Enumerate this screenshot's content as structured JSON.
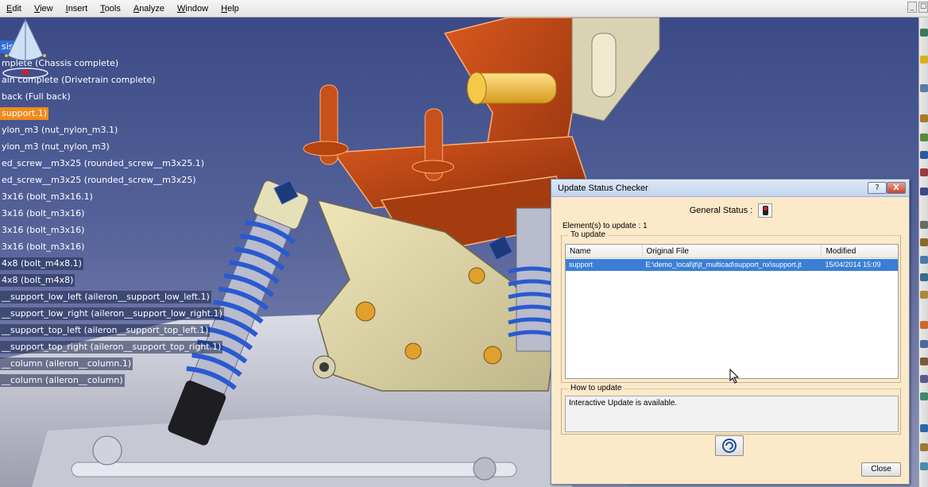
{
  "menu": [
    "Edit",
    "View",
    "Insert",
    "Tools",
    "Analyze",
    "Window",
    "Help"
  ],
  "window_buttons": [
    "_",
    "☐"
  ],
  "tree": [
    {
      "label": "sis",
      "style": "selected"
    },
    {
      "label": "mplete (Chassis complete)",
      "style": "plain"
    },
    {
      "label": "ain complete (Drivetrain complete)",
      "style": "plain"
    },
    {
      "label": "back (Full back)",
      "style": "plain"
    },
    {
      "label": "support.1)",
      "style": "orange"
    },
    {
      "label": "ylon_m3 (nut_nylon_m3.1)",
      "style": "plain"
    },
    {
      "label": "ylon_m3 (nut_nylon_m3)",
      "style": "plain"
    },
    {
      "label": "ed_screw__m3x25 (rounded_screw__m3x25.1)",
      "style": "plain"
    },
    {
      "label": "ed_screw__m3x25 (rounded_screw__m3x25)",
      "style": "plain"
    },
    {
      "label": "3x16 (bolt_m3x16.1)",
      "style": "plain"
    },
    {
      "label": "3x16 (bolt_m3x16)",
      "style": "plain"
    },
    {
      "label": "3x16 (bolt_m3x16)",
      "style": "plain"
    },
    {
      "label": "3x16 (bolt_m3x16)",
      "style": "plain"
    },
    {
      "label": "4x8 (bolt_m4x8.1)",
      "style": "boxed"
    },
    {
      "label": "4x8 (bolt_m4x8)",
      "style": "boxed"
    },
    {
      "label": "__support_low_left (aileron__support_low_left.1)",
      "style": "boxed"
    },
    {
      "label": "__support_low_right (aileron__support_low_right.1)",
      "style": "boxed"
    },
    {
      "label": "__support_top_left (aileron__support_top_left.1)",
      "style": "boxed"
    },
    {
      "label": "__support_top_right (aileron__support_top_right.1)",
      "style": "boxed"
    },
    {
      "label": "__column (aileron__column.1)",
      "style": "boxed"
    },
    {
      "label": "__column (aileron__column)",
      "style": "boxed"
    }
  ],
  "dialog": {
    "title": "Update Status Checker",
    "help_button": "?",
    "close_x": "X",
    "general_status_label": "General Status :",
    "elements_count": "Element(s) to update : 1",
    "to_update_legend": "To update",
    "columns": [
      "Name",
      "Original File",
      "Modified"
    ],
    "rows": [
      {
        "name": "support",
        "file": "E:\\demo_local\\jt\\jt_multicad\\support_nx\\support.jt",
        "modified": "15/04/2014 15:09"
      }
    ],
    "how_to_update_legend": "How to update",
    "how_to_update_text": "Interactive Update is available.",
    "close_button": "Close"
  },
  "colors": {
    "tree_selected": "#2f6fd6",
    "tree_highlight": "#f28a1c",
    "dialog_bg": "#fbe9c9",
    "row_selected": "#3a7fd5"
  }
}
